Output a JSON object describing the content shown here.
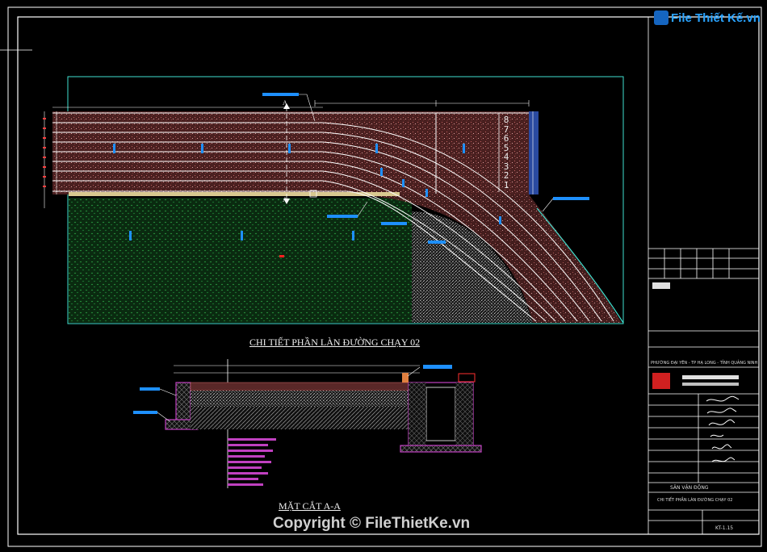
{
  "brand": {
    "logo_text": "File Thiết Kế.vn",
    "copyright": "Copyright © FileThietKe.vn"
  },
  "drawing": {
    "plan_title": "CHI TIẾT PHẦN LÀN ĐƯỜNG CHẠY 02",
    "section_title": "MẶT CẮT A-A",
    "section_marker": "A",
    "lane_numbers": [
      "8",
      "7",
      "6",
      "5",
      "4",
      "3",
      "2",
      "1"
    ]
  },
  "title_block": {
    "project_name": "SÂN VẬN ĐỘNG",
    "sheet_title": "CHI TIẾT PHẦN LÀN ĐƯỜNG CHẠY 02",
    "sheet_number": "KT-1.15",
    "location": "PHƯỜNG ĐẠI YÊN - TP HẠ LONG - TỈNH QUẢNG NINH"
  },
  "colors": {
    "frame": "#ffffff",
    "boundary": "#40e0d0",
    "track": "#5a2828",
    "lane_line": "#ffffff",
    "grass": "#0e3a16",
    "gravel": "#8a8a8a",
    "magenta": "#c040c0",
    "label_blue": "#1e90ff",
    "brand_blue": "#29a3ff"
  }
}
